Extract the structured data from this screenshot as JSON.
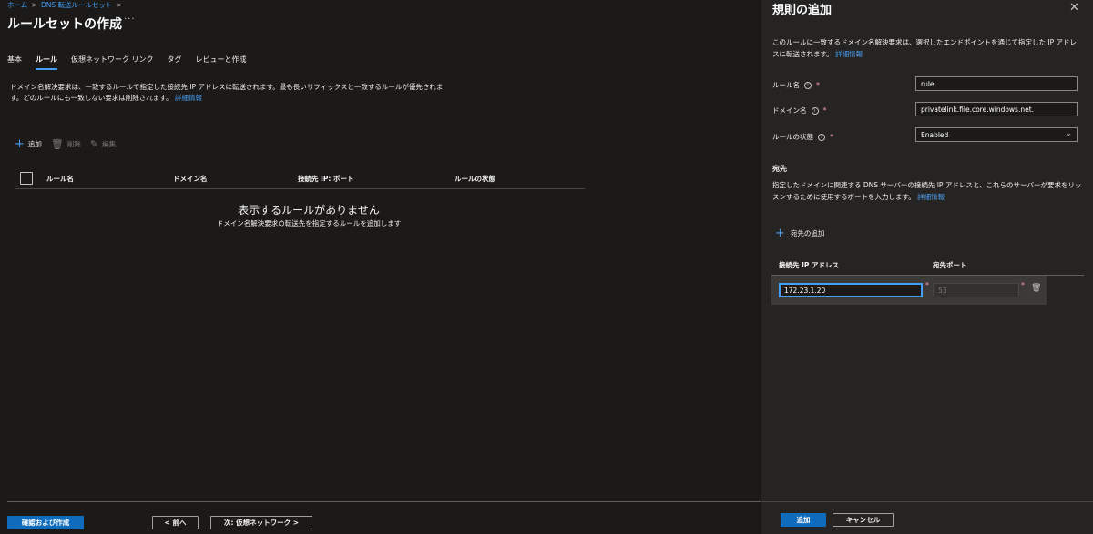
{
  "breadcrumb": {
    "home": "ホーム",
    "ruleset": "DNS 転送ルールセット",
    "sep": ">"
  },
  "page": {
    "title": "ルールセットの作成",
    "more": "···"
  },
  "tabs": [
    "基本",
    "ルール",
    "仮想ネットワーク リンク",
    "タグ",
    "レビューと作成"
  ],
  "active_tab": "ルール",
  "description": {
    "text": "ドメイン名解決要求は、一致するルールで指定した接続先 IP アドレスに転送されます。最も長いサフィックスと一致するルールが優先されます。どのルールにも一致しない要求は削除されます。",
    "link": "詳細情報"
  },
  "toolbar": {
    "add": "追加",
    "delete": "削除",
    "edit": "編集"
  },
  "grid": {
    "columns": [
      "ルール名",
      "ドメイン名",
      "接続先 IP: ポート",
      "ルールの状態"
    ]
  },
  "empty": {
    "title": "表示するルールがありません",
    "subtitle": "ドメイン名解決要求の転送先を指定するルールを追加します"
  },
  "footer": {
    "review": "確認および作成",
    "prev": "< 前へ",
    "next": "次: 仮想ネットワーク >"
  },
  "panel": {
    "title": "規則の追加",
    "close": "✕",
    "desc": "このルールに一致するドメイン名解決要求は、選択したエンドポイントを通じて指定した IP アドレスに転送されます。",
    "desc_link": "詳細情報",
    "rule_name_label": "ルール名",
    "rule_name_value": "rule",
    "domain_label": "ドメイン名",
    "domain_value": "privatelink.file.core.windows.net.",
    "state_label": "ルールの状態",
    "state_value": "Enabled",
    "dest_section": "宛先",
    "dest_desc": "指定したドメインに関連する DNS サーバーの接続先 IP アドレスと、これらのサーバーが要求をリッスンするために使用するポートを入力します。",
    "dest_link": "詳細情報",
    "add_dest": "宛先の追加",
    "dest_columns": [
      "接続先 IP アドレス",
      "宛先ポート"
    ],
    "ip_value": "172.23.1.20",
    "port_placeholder": "53",
    "add_button": "追加",
    "cancel_button": "キャンセル"
  },
  "colors": {
    "accent": "#479ef5",
    "primary_button": "#0f6cbd",
    "required": "#ff99a4",
    "background": "#1b1a19",
    "panel": "#252423"
  }
}
